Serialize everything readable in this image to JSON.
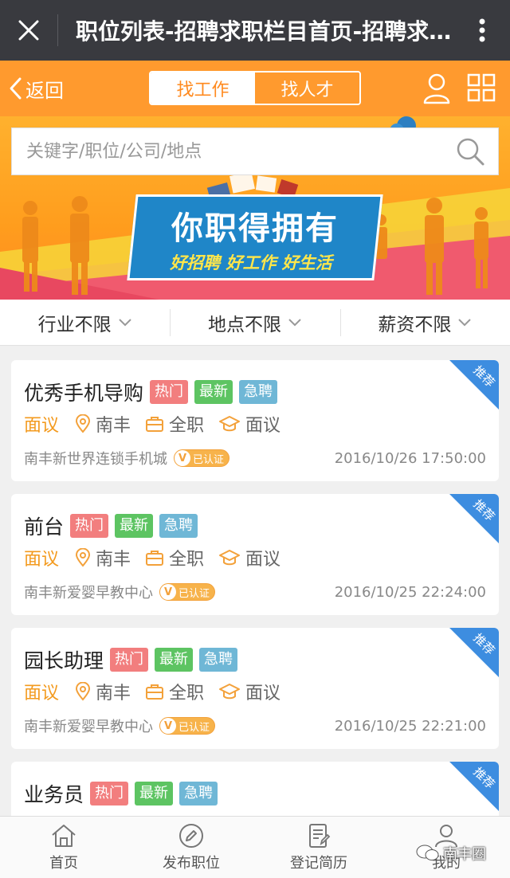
{
  "window": {
    "title": "职位列表-招聘求职栏目首页-招聘求..."
  },
  "header": {
    "back_label": "返回",
    "tabs": [
      {
        "label": "找工作",
        "active": true
      },
      {
        "label": "找人才",
        "active": false
      }
    ]
  },
  "search": {
    "placeholder": "关键字/职位/公司/地点"
  },
  "banner": {
    "headline": "你职得拥有",
    "slogan": "好招聘 好工作 好生活"
  },
  "filters": [
    {
      "label": "行业不限"
    },
    {
      "label": "地点不限"
    },
    {
      "label": "薪资不限"
    }
  ],
  "jobs": [
    {
      "title": "优秀手机导购",
      "tags": [
        "热门",
        "最新",
        "急聘"
      ],
      "salary": "面议",
      "location": "南丰",
      "type": "全职",
      "education": "面议",
      "company": "南丰新世界连锁手机城",
      "verified": "已认证",
      "time": "2016/10/26 17:50:00",
      "ribbon": "推荐"
    },
    {
      "title": "前台",
      "tags": [
        "热门",
        "最新",
        "急聘"
      ],
      "salary": "面议",
      "location": "南丰",
      "type": "全职",
      "education": "面议",
      "company": "南丰新爱婴早教中心",
      "verified": "已认证",
      "time": "2016/10/25 22:24:00",
      "ribbon": "推荐"
    },
    {
      "title": "园长助理",
      "tags": [
        "热门",
        "最新",
        "急聘"
      ],
      "salary": "面议",
      "location": "南丰",
      "type": "全职",
      "education": "面议",
      "company": "南丰新爱婴早教中心",
      "verified": "已认证",
      "time": "2016/10/25 22:21:00",
      "ribbon": "推荐"
    },
    {
      "title": "业务员",
      "tags": [
        "热门",
        "最新",
        "急聘"
      ],
      "ribbon": "推荐"
    }
  ],
  "tabbar": [
    {
      "label": "首页",
      "icon": "home-icon"
    },
    {
      "label": "发布职位",
      "icon": "edit-icon"
    },
    {
      "label": "登记简历",
      "icon": "resume-icon"
    },
    {
      "label": "我的",
      "icon": "user-icon"
    }
  ],
  "watermark": "南丰圈",
  "colors": {
    "brand": "#ff9a2e",
    "wx_bar": "#393a3f",
    "ribbon": "#3d8de0",
    "salary": "#f39a1e"
  }
}
